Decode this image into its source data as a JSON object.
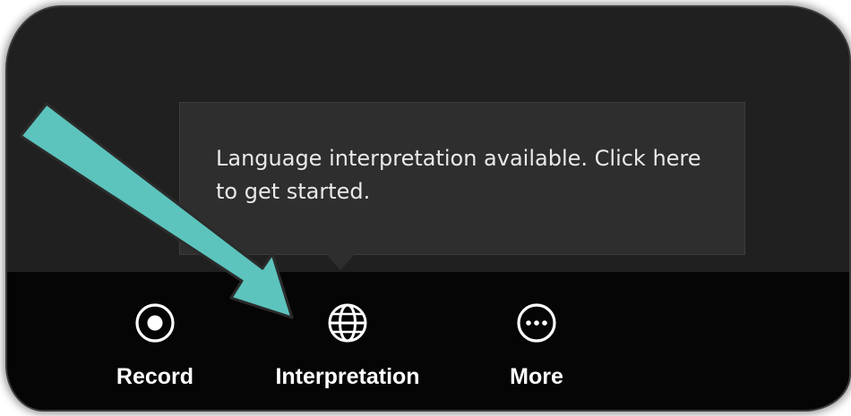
{
  "tooltip": {
    "text": "Language interpretation available. Click here to get started."
  },
  "toolbar": {
    "record_label": "Record",
    "interpretation_label": "Interpretation",
    "more_label": "More"
  },
  "icons": {
    "record": "record-icon",
    "interpretation": "globe-icon",
    "more": "more-icon"
  },
  "colors": {
    "arrow_fill": "#5cc4bd",
    "arrow_stroke": "#2b2b2b",
    "toolbar_bg": "#050505",
    "tooltip_bg": "#2e2e2e"
  }
}
